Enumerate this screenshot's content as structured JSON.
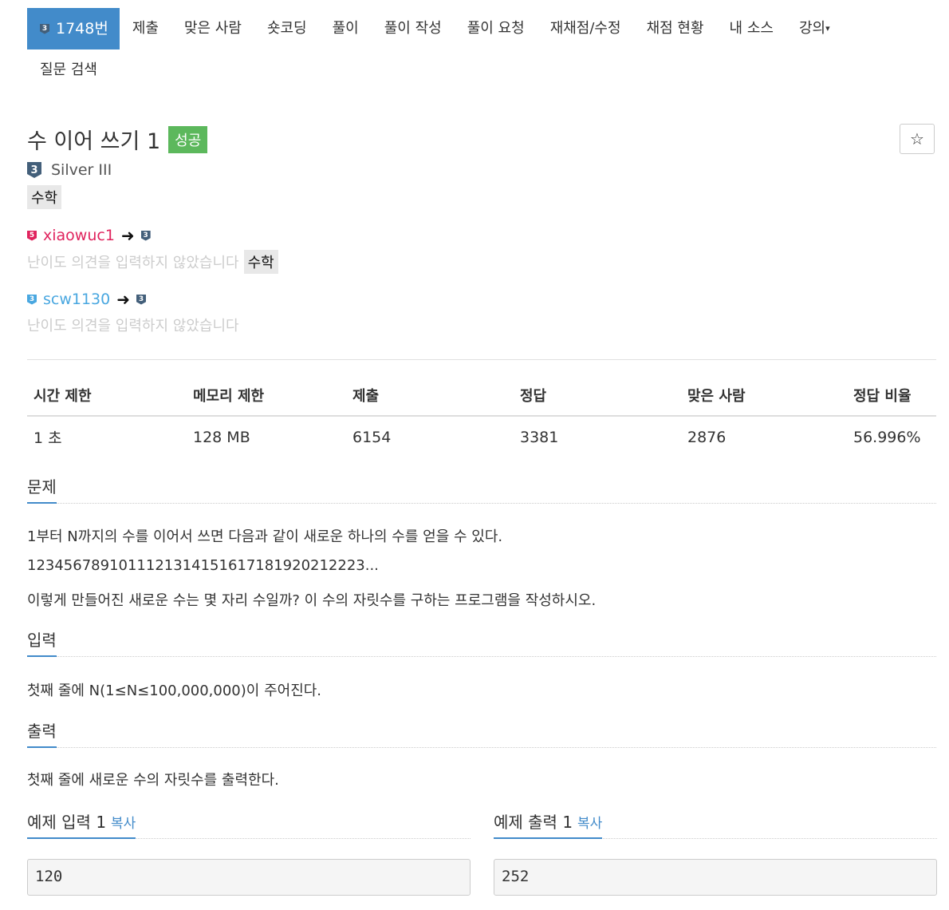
{
  "nav": {
    "problem_tier": "3",
    "problem_number": "1748번",
    "items": [
      "제출",
      "맞은 사람",
      "숏코딩",
      "풀이",
      "풀이 작성",
      "풀이 요청",
      "재채점/수정",
      "채점 현황",
      "내 소스",
      "강의"
    ],
    "row2": [
      "질문 검색"
    ]
  },
  "problem": {
    "title": "수 이어 쓰기 1",
    "status": "성공",
    "star": "☆",
    "tier_icon": "3",
    "tier_name": "Silver III",
    "tag": "수학"
  },
  "opinions": [
    {
      "tier": "5",
      "user": "xiaowuc1",
      "arrow": "➜",
      "to_tier": "3",
      "note": "난이도 의견을 입력하지 않았습니다",
      "tag": "수학"
    },
    {
      "tier": "3",
      "user": "scw1130",
      "arrow": "➜",
      "to_tier": "3",
      "note": "난이도 의견을 입력하지 않았습니다"
    }
  ],
  "stats": {
    "headers": [
      "시간 제한",
      "메모리 제한",
      "제출",
      "정답",
      "맞은 사람",
      "정답 비율"
    ],
    "values": [
      "1 초",
      "128 MB",
      "6154",
      "3381",
      "2876",
      "56.996%"
    ]
  },
  "sections": {
    "problem_title": "문제",
    "problem_lines": [
      "1부터 N까지의 수를 이어서 쓰면 다음과 같이 새로운 하나의 수를 얻을 수 있다.",
      "1234567891011121314151617181920212223...",
      "이렇게 만들어진 새로운 수는 몇 자리 수일까? 이 수의 자릿수를 구하는 프로그램을 작성하시오."
    ],
    "input_title": "입력",
    "input_text": "첫째 줄에 N(1≤N≤100,000,000)이 주어진다.",
    "output_title": "출력",
    "output_text": "첫째 줄에 새로운 수의 자릿수를 출력한다."
  },
  "samples": {
    "input_title": "예제 입력 1",
    "output_title": "예제 출력 1",
    "copy_label": "복사",
    "input_value": "120",
    "output_value": "252"
  },
  "colors": {
    "accent": "#428bca",
    "success": "#5cb85c",
    "ruby": "#e0245e",
    "sky": "#49a7e0"
  }
}
